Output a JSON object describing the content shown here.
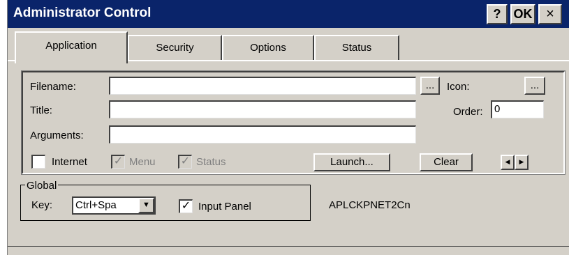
{
  "window": {
    "title": "Administrator Control",
    "help_label": "?",
    "ok_label": "OK",
    "close_label": "×"
  },
  "tabs": [
    {
      "label": "Application",
      "active": true
    },
    {
      "label": "Security",
      "active": false
    },
    {
      "label": "Options",
      "active": false
    },
    {
      "label": "Status",
      "active": false
    }
  ],
  "application": {
    "filename_label": "Filename:",
    "filename_value": "",
    "filename_browse": "...",
    "icon_label": "Icon:",
    "icon_browse": "...",
    "title_label": "Title:",
    "title_value": "",
    "order_label": "Order:",
    "order_value": "0",
    "arguments_label": "Arguments:",
    "arguments_value": "",
    "internet_label": "Internet",
    "internet_checked": false,
    "menu_label": "Menu",
    "menu_checked": true,
    "status_label": "Status",
    "status_checked": true,
    "launch_label": "Launch...",
    "clear_label": "Clear",
    "prev_glyph": "◀",
    "next_glyph": "▶"
  },
  "global": {
    "group_label": "Global",
    "key_label": "Key:",
    "key_value": "Ctrl+Spa",
    "dropdown_glyph": "▼",
    "input_panel_label": "Input Panel",
    "input_panel_checked": true,
    "machine_name": "APLCKPNET2Cn"
  },
  "colors": {
    "titlebar": "#0a246a",
    "face": "#d4d0c8"
  }
}
